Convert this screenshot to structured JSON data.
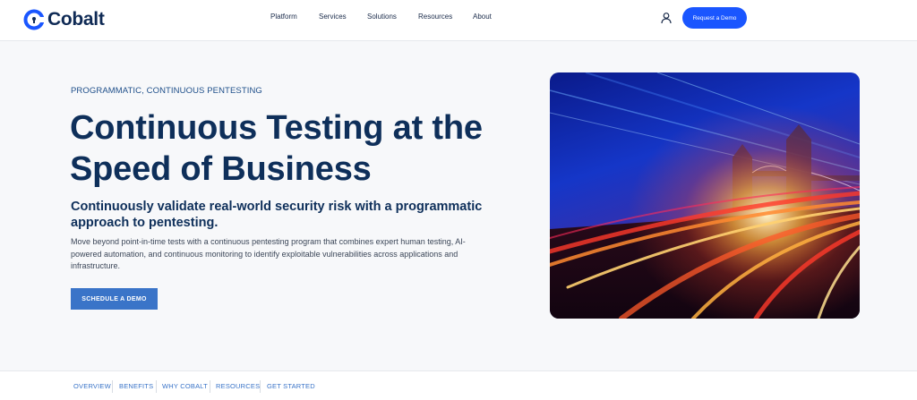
{
  "brand": {
    "name": "Cobalt",
    "accent": "#1a56ff",
    "navy": "#0e2f5a"
  },
  "nav": {
    "items": [
      {
        "label": "Platform"
      },
      {
        "label": "Services"
      },
      {
        "label": "Solutions"
      },
      {
        "label": "Resources"
      },
      {
        "label": "About"
      }
    ],
    "user_icon": "user-icon",
    "cta_label": "Request a Demo"
  },
  "hero": {
    "eyebrow": "PROGRAMMATIC, CONTINUOUS PENTESTING",
    "headline": "Continuous Testing at the Speed of Business",
    "subhead": "Continuously validate real-world security risk with a programmatic approach to pentesting.",
    "body": "Move beyond point-in-time tests with a continuous pentesting program that combines expert human testing, AI-powered automation, and continuous monitoring to identify exploitable vulnerabilities across applications and infrastructure.",
    "cta_label": "SCHEDULE A DEMO"
  },
  "subnav": {
    "items": [
      {
        "label": "OVERVIEW"
      },
      {
        "label": "BENEFITS"
      },
      {
        "label": "WHY COBALT"
      },
      {
        "label": "RESOURCES"
      },
      {
        "label": "GET STARTED"
      }
    ]
  }
}
